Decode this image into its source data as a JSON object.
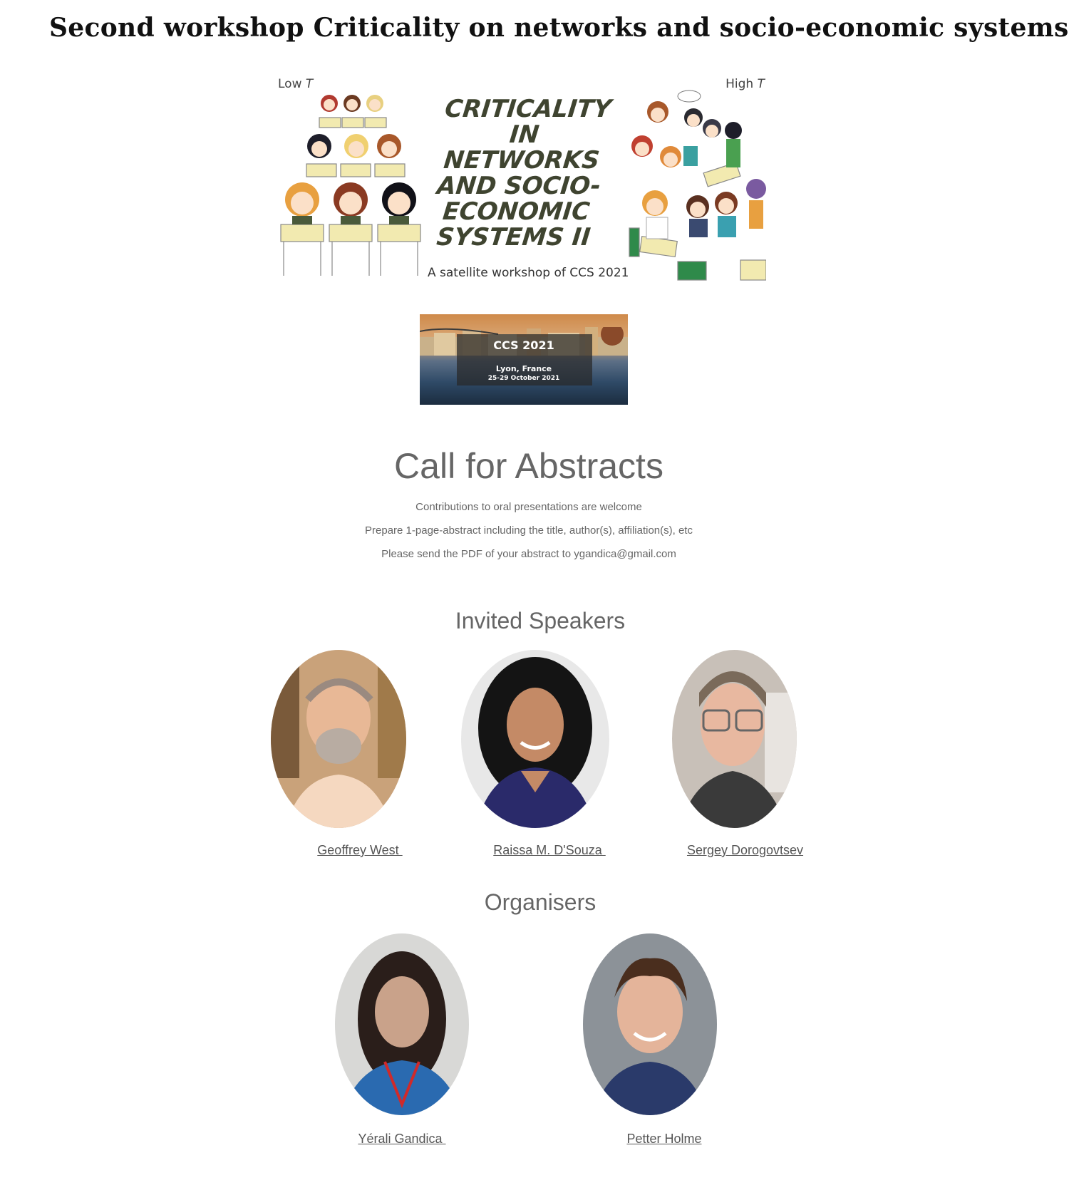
{
  "page": {
    "title": "Second workshop Criticality on networks and socio-economic systems"
  },
  "banner": {
    "low_label": "Low",
    "high_label": "High",
    "temperature_symbol": "T",
    "title_lines": [
      "CRITICALITY",
      "IN",
      "NETWORKS",
      "AND SOCIO-",
      "ECONOMIC",
      "SYSTEMS II"
    ],
    "subtitle": "A satellite workshop of CCS 2021",
    "title_color": "#3f4430"
  },
  "ccs_badge": {
    "name": "CCS 2021",
    "place": "Lyon, France",
    "dates": "25-29 October 2021"
  },
  "call_for_abstracts": {
    "heading": "Call for Abstracts",
    "lines": [
      "Contributions to oral presentations are welcome",
      "Prepare 1-page-abstract including the title, author(s), affiliation(s), etc",
      "Please send the PDF of your abstract to ygandica@gmail.com"
    ]
  },
  "invited_speakers": {
    "heading": "Invited Speakers",
    "people": [
      {
        "name": "Geoffrey West "
      },
      {
        "name": "Raissa M. D'Souza "
      },
      {
        "name": "Sergey Dorogovtsev"
      }
    ]
  },
  "organisers": {
    "heading": "Organisers",
    "people": [
      {
        "name": "Yérali Gandica "
      },
      {
        "name": "Petter Holme"
      }
    ]
  },
  "colors": {
    "text": "#555555",
    "heading": "#666666",
    "title": "#111111"
  }
}
